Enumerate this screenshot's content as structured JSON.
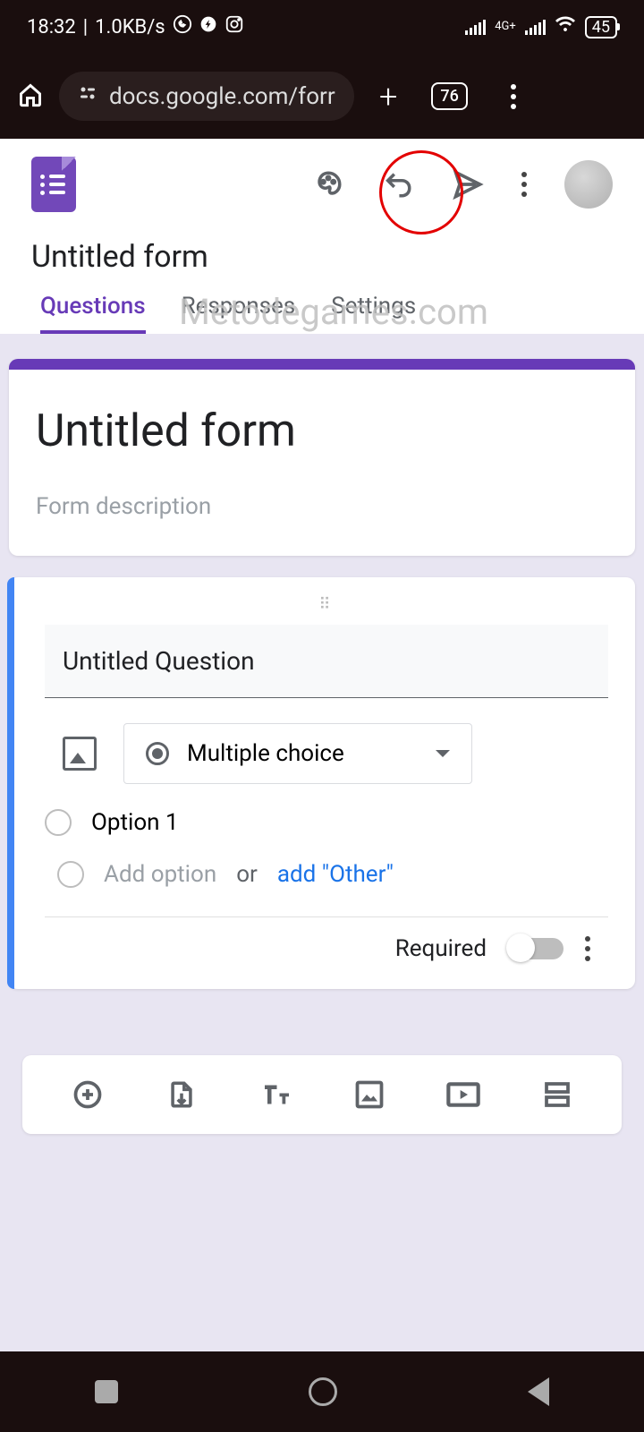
{
  "status": {
    "time": "18:32",
    "speed": "1.0KB/s",
    "net_label": "4G+",
    "battery": "45"
  },
  "browser": {
    "url": "docs.google.com/forr",
    "tab_count": "76"
  },
  "header": {
    "form_name": "Untitled form"
  },
  "watermark": "Metodegames.com",
  "tabs": {
    "questions": "Questions",
    "responses": "Responses",
    "settings": "Settings"
  },
  "title_card": {
    "title": "Untitled form",
    "description": "Form description"
  },
  "question": {
    "title": "Untitled Question",
    "type_label": "Multiple choice",
    "option1": "Option 1",
    "add_option": "Add option",
    "or": "or",
    "add_other": "add \"Other\"",
    "required": "Required"
  }
}
